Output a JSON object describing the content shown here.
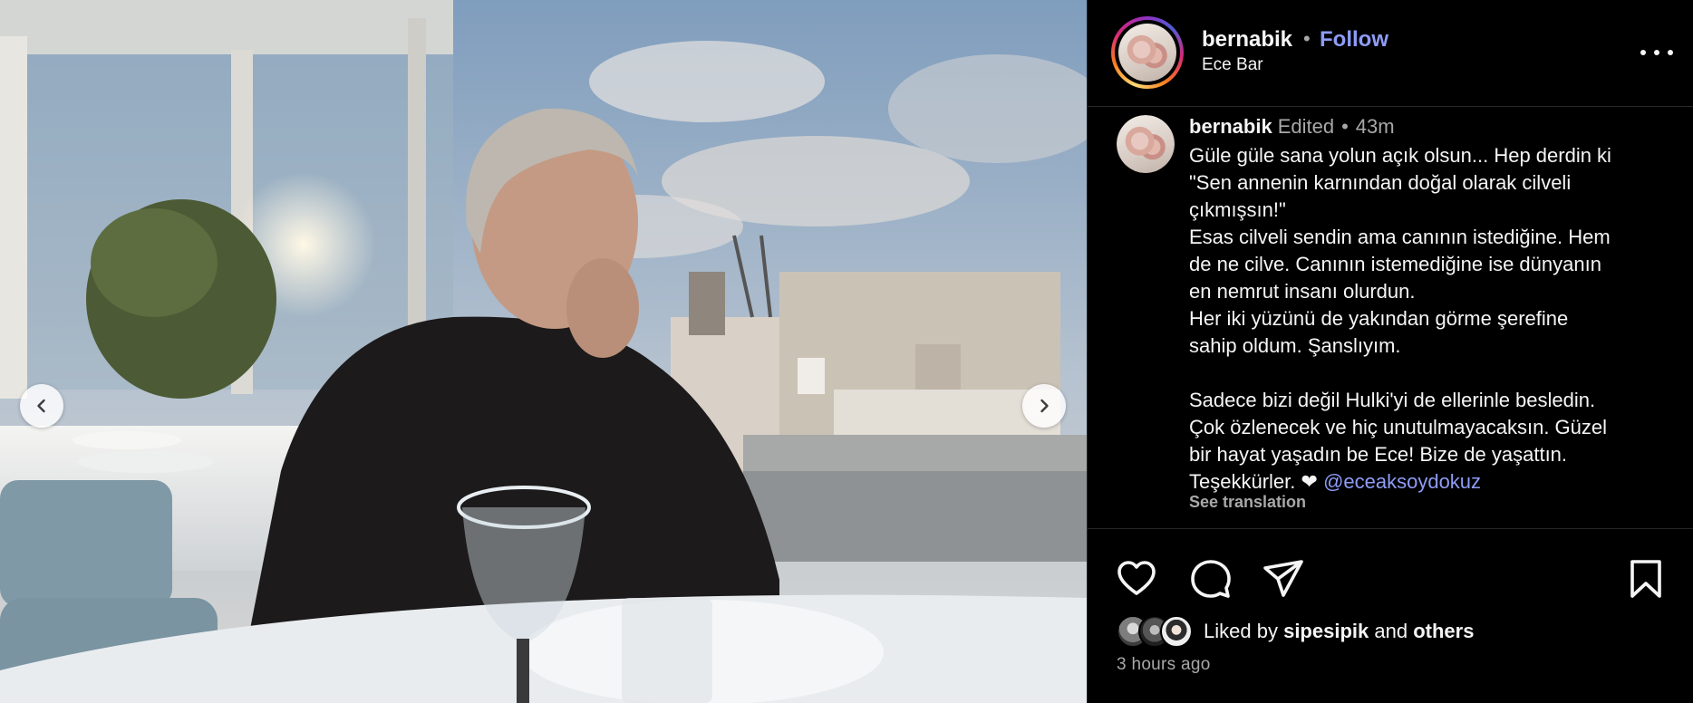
{
  "post": {
    "author": {
      "username": "bernabik",
      "follow_label": "Follow",
      "separator": "•",
      "location": "Ece Bar",
      "avatar_icon": "profile-photo"
    },
    "caption": {
      "username": "bernabik",
      "edited_label": "Edited",
      "separator": "•",
      "time": "43m",
      "lines": [
        "Güle güle sana yolun açık olsun... Hep derdin ki",
        "\"Sen annenin karnından doğal olarak cilveli",
        "çıkmışsın!\"",
        "Esas cilveli sendin ama canının istediğine. Hem",
        "de ne cilve. Canının istemediğine ise dünyanın",
        "en nemrut insanı olurdun.",
        "Her iki yüzünü de yakından görme şerefine",
        "sahip oldum. Şanslıyım.",
        "",
        "Sadece bizi değil Hulki'yi de ellerinle besledin.",
        "Çok özlenecek ve hiç unutulmayacaksın. Güzel",
        "bir hayat yaşadın be Ece! Bize de yaşattın."
      ],
      "last_line_text": "Teşekkürler. ❤",
      "mention": "@eceaksoydokuz",
      "see_translation": "See translation"
    },
    "actions": {
      "like_icon": "heart-icon",
      "comment_icon": "comment-icon",
      "share_icon": "send-icon",
      "save_icon": "bookmark-icon"
    },
    "likes": {
      "prefix": "Liked by",
      "first_liker": "sipesipik",
      "conjunction": "and",
      "others": "others"
    },
    "timestamp": "3 hours ago"
  },
  "media": {
    "prev_icon": "chevron-left-icon",
    "next_icon": "chevron-right-icon"
  },
  "colors": {
    "background": "#000000",
    "text": "#f5f5f5",
    "secondary_text": "#a8a8a8",
    "link": "#8e9cf6",
    "divider": "#262626"
  }
}
